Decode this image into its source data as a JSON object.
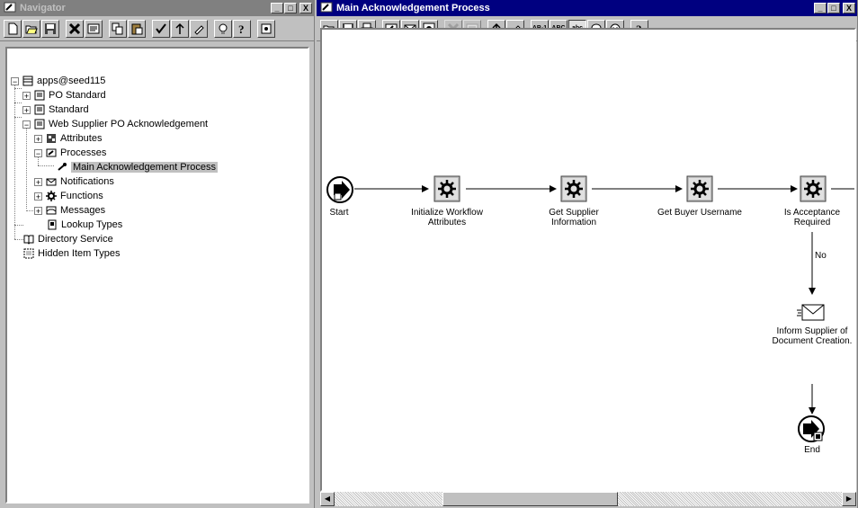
{
  "navigator": {
    "title": "Navigator",
    "toolbar": [
      "new-icon",
      "open-icon",
      "save-icon",
      "delete-icon",
      "properties-icon",
      "copy-icon",
      "paste-icon",
      "verify-icon",
      "arrow-up-icon",
      "edit-icon",
      "help-bulb-icon",
      "help-icon",
      "mode-icon"
    ],
    "tree": {
      "root": "apps@seed115",
      "items": {
        "po_standard": "PO Standard",
        "standard": "Standard",
        "web_supplier": "Web Supplier PO Acknowledgement",
        "attributes": "Attributes",
        "processes": "Processes",
        "main_process": "Main Acknowledgement Process",
        "notifications": "Notifications",
        "functions": "Functions",
        "messages": "Messages",
        "lookup_types": "Lookup Types",
        "directory_service": "Directory Service",
        "hidden_item_types": "Hidden Item Types"
      }
    }
  },
  "process": {
    "title": "Main Acknowledgement Process",
    "toolbar": [
      "open-icon",
      "save-icon",
      "print-icon",
      "new-process-icon",
      "new-notification-icon",
      "new-function-icon",
      "delete-icon",
      "properties-icon",
      "arrow-up-icon",
      "edit-icon",
      "label-ab1-icon",
      "label-abc-upper-icon",
      "label-abc-lower-icon",
      "comment-icon",
      "face-icon",
      "help-icon"
    ],
    "toolbar_text": {
      "ab1": "AB-1",
      "abc_upper": "ABC",
      "abc_lower": "abc",
      "help": "?"
    },
    "nodes": {
      "start": "Start",
      "init": "Initialize Workflow\nAttributes",
      "get_supplier": "Get Supplier\nInformation",
      "get_buyer": "Get Buyer Username",
      "is_acceptance": "Is Acceptance\nRequired",
      "inform_supplier": "Inform Supplier of\nDocument Creation.",
      "end": "End"
    },
    "edge_labels": {
      "no": "No"
    }
  },
  "window_buttons": {
    "minimize": "_",
    "maximize": "□",
    "close": "X"
  },
  "colors": {
    "title_active": "#000080",
    "title_inactive": "#808080",
    "chrome": "#c0c0c0"
  }
}
